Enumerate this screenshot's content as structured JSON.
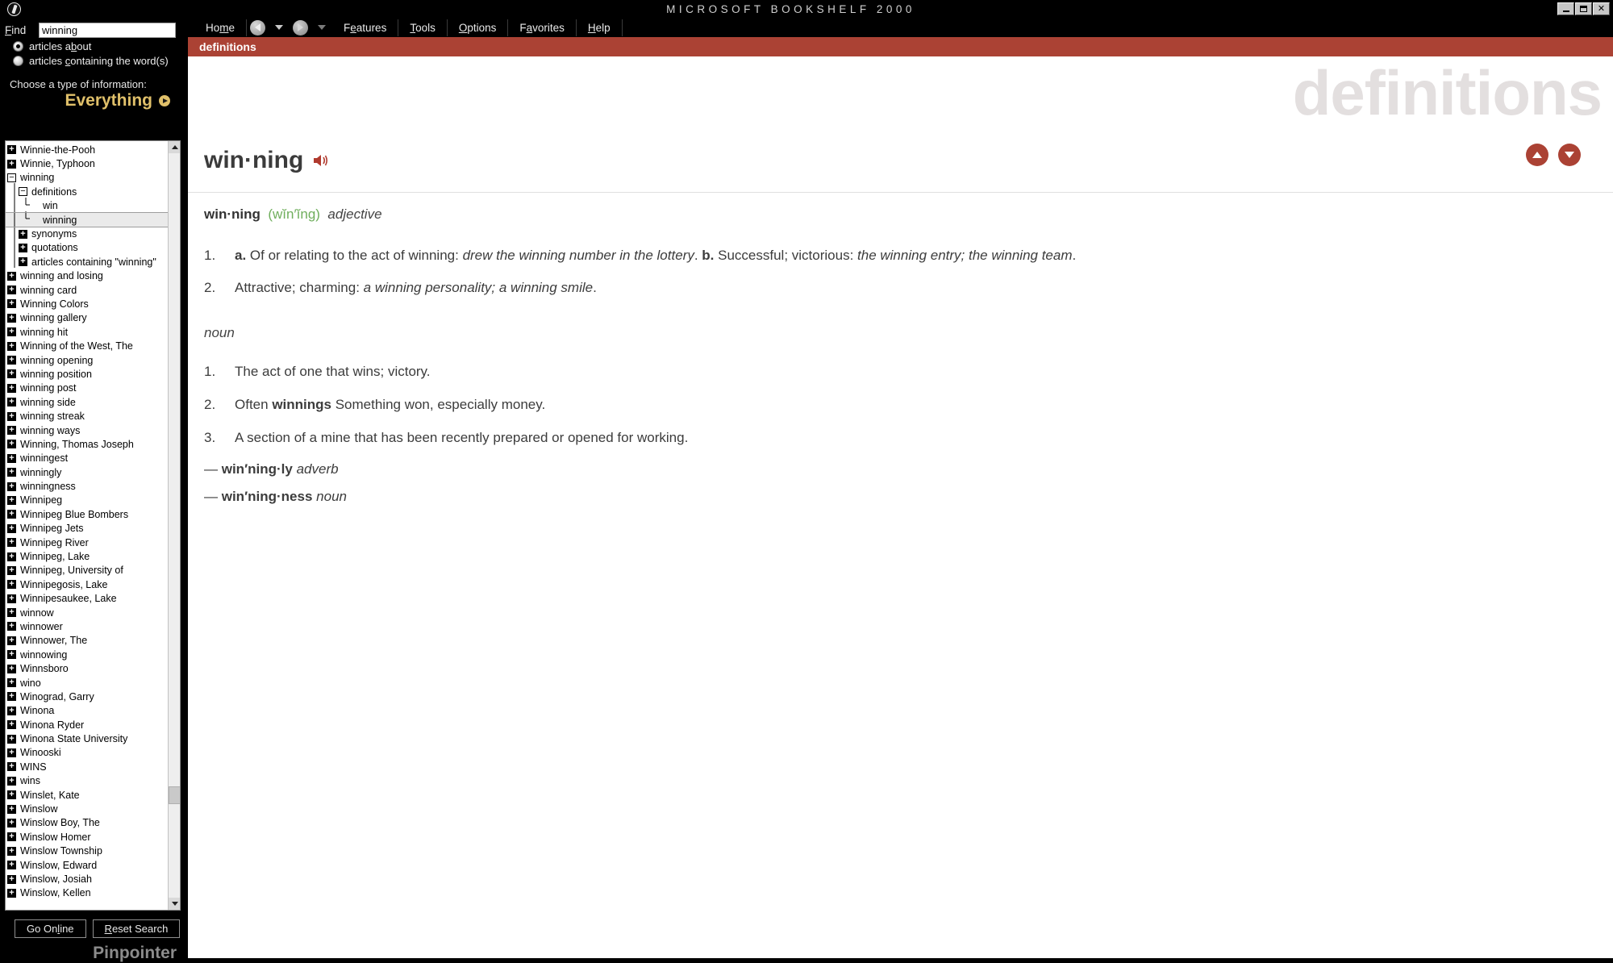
{
  "window": {
    "title": "MICROSOFT BOOKSHELF 2000",
    "logo_icon": "bookshelf-disc-icon",
    "controls": [
      {
        "name": "minimize-button",
        "glyph": "minimize-icon"
      },
      {
        "name": "maximize-button",
        "glyph": "maximize-icon"
      },
      {
        "name": "close-button",
        "glyph": "close-icon",
        "label": "×"
      }
    ]
  },
  "sidebar": {
    "find_label": "Find",
    "find_label_accel": "F",
    "find_value": "winning",
    "find_placeholder": "",
    "radios": [
      {
        "label": "articles about",
        "accel": "b",
        "selected": true
      },
      {
        "label": "articles containing the word(s)",
        "accel": "c",
        "selected": false
      }
    ],
    "choose_label": "Choose a type of information:",
    "type_value": "Everything",
    "type_arrow_icon": "arrow-right-circle-icon",
    "tree": [
      {
        "label": "Winnie-the-Pooh",
        "depth": 0,
        "expander": "plus"
      },
      {
        "label": "Winnie, Typhoon",
        "depth": 0,
        "expander": "plus"
      },
      {
        "label": "winning",
        "depth": 0,
        "expander": "minus"
      },
      {
        "label": "definitions",
        "depth": 1,
        "expander": "minus"
      },
      {
        "label": "win",
        "depth": 2,
        "expander": "leaf"
      },
      {
        "label": "winning",
        "depth": 2,
        "expander": "leaf-last",
        "selected": true
      },
      {
        "label": "synonyms",
        "depth": 1,
        "expander": "plus"
      },
      {
        "label": "quotations",
        "depth": 1,
        "expander": "plus"
      },
      {
        "label": "articles containing \"winning\"",
        "depth": 1,
        "expander": "plus-last"
      },
      {
        "label": "winning and losing",
        "depth": 0,
        "expander": "plus"
      },
      {
        "label": "winning card",
        "depth": 0,
        "expander": "plus"
      },
      {
        "label": "Winning Colors",
        "depth": 0,
        "expander": "plus"
      },
      {
        "label": "winning gallery",
        "depth": 0,
        "expander": "plus"
      },
      {
        "label": "winning hit",
        "depth": 0,
        "expander": "plus"
      },
      {
        "label": "Winning of the West, The",
        "depth": 0,
        "expander": "plus"
      },
      {
        "label": "winning opening",
        "depth": 0,
        "expander": "plus"
      },
      {
        "label": "winning position",
        "depth": 0,
        "expander": "plus"
      },
      {
        "label": "winning post",
        "depth": 0,
        "expander": "plus"
      },
      {
        "label": "winning side",
        "depth": 0,
        "expander": "plus"
      },
      {
        "label": "winning streak",
        "depth": 0,
        "expander": "plus"
      },
      {
        "label": "winning ways",
        "depth": 0,
        "expander": "plus"
      },
      {
        "label": "Winning, Thomas Joseph",
        "depth": 0,
        "expander": "plus"
      },
      {
        "label": "winningest",
        "depth": 0,
        "expander": "plus"
      },
      {
        "label": "winningly",
        "depth": 0,
        "expander": "plus"
      },
      {
        "label": "winningness",
        "depth": 0,
        "expander": "plus"
      },
      {
        "label": "Winnipeg",
        "depth": 0,
        "expander": "plus"
      },
      {
        "label": "Winnipeg Blue Bombers",
        "depth": 0,
        "expander": "plus"
      },
      {
        "label": "Winnipeg Jets",
        "depth": 0,
        "expander": "plus"
      },
      {
        "label": "Winnipeg River",
        "depth": 0,
        "expander": "plus"
      },
      {
        "label": "Winnipeg, Lake",
        "depth": 0,
        "expander": "plus"
      },
      {
        "label": "Winnipeg, University of",
        "depth": 0,
        "expander": "plus"
      },
      {
        "label": "Winnipegosis, Lake",
        "depth": 0,
        "expander": "plus"
      },
      {
        "label": "Winnipesaukee, Lake",
        "depth": 0,
        "expander": "plus"
      },
      {
        "label": "winnow",
        "depth": 0,
        "expander": "plus"
      },
      {
        "label": "winnower",
        "depth": 0,
        "expander": "plus"
      },
      {
        "label": "Winnower, The",
        "depth": 0,
        "expander": "plus"
      },
      {
        "label": "winnowing",
        "depth": 0,
        "expander": "plus"
      },
      {
        "label": "Winnsboro",
        "depth": 0,
        "expander": "plus"
      },
      {
        "label": "wino",
        "depth": 0,
        "expander": "plus"
      },
      {
        "label": "Winograd, Garry",
        "depth": 0,
        "expander": "plus"
      },
      {
        "label": "Winona",
        "depth": 0,
        "expander": "plus"
      },
      {
        "label": "Winona Ryder",
        "depth": 0,
        "expander": "plus"
      },
      {
        "label": "Winona State University",
        "depth": 0,
        "expander": "plus"
      },
      {
        "label": "Winooski",
        "depth": 0,
        "expander": "plus"
      },
      {
        "label": "WINS",
        "depth": 0,
        "expander": "plus"
      },
      {
        "label": "wins",
        "depth": 0,
        "expander": "plus"
      },
      {
        "label": "Winslet, Kate",
        "depth": 0,
        "expander": "plus"
      },
      {
        "label": "Winslow",
        "depth": 0,
        "expander": "plus"
      },
      {
        "label": "Winslow Boy, The",
        "depth": 0,
        "expander": "plus"
      },
      {
        "label": "Winslow Homer",
        "depth": 0,
        "expander": "plus"
      },
      {
        "label": "Winslow Township",
        "depth": 0,
        "expander": "plus"
      },
      {
        "label": "Winslow, Edward",
        "depth": 0,
        "expander": "plus"
      },
      {
        "label": "Winslow, Josiah",
        "depth": 0,
        "expander": "plus"
      },
      {
        "label": "Winslow, Kellen",
        "depth": 0,
        "expander": "plus"
      }
    ],
    "go_online_label": "Go Online",
    "go_online_accel": "l",
    "reset_search_label": "Reset Search",
    "reset_search_accel": "R",
    "pinpointer_label": "Pinpointer"
  },
  "menubar": {
    "home_label": "Home",
    "home_accel": "m",
    "back_icon": "back-arrow-icon",
    "back_dropdown_icon": "chevron-down-icon",
    "forward_icon": "forward-arrow-icon",
    "forward_dropdown_icon": "chevron-down-icon",
    "items": [
      {
        "label": "Features",
        "accel": "e"
      },
      {
        "label": "Tools",
        "accel": "T"
      },
      {
        "label": "Options",
        "accel": "O"
      },
      {
        "label": "Favorites",
        "accel": "a"
      },
      {
        "label": "Help",
        "accel": "H"
      }
    ]
  },
  "banner": {
    "tab_label": "definitions",
    "watermark": "definitions",
    "color": "#ab4234",
    "nav_up_icon": "arrow-up-circle-icon",
    "nav_down_icon": "arrow-down-circle-icon"
  },
  "article": {
    "headword": "win·ning",
    "audio_icon": "speaker-icon",
    "entry_headword": "win·ning",
    "pronunciation": "(wĭn′ĭng)",
    "part_of_speech_1": "adjective",
    "adjective_senses": [
      {
        "num": "1.",
        "parts": [
          {
            "text": "a.",
            "style": "bold"
          },
          {
            "text": " Of or relating to the act of winning: ",
            "style": "plain"
          },
          {
            "text": "drew the winning number in the lottery",
            "style": "italic"
          },
          {
            "text": ". ",
            "style": "plain"
          },
          {
            "text": "b.",
            "style": "bold"
          },
          {
            "text": " Successful; victorious: ",
            "style": "plain"
          },
          {
            "text": "the winning entry; the winning team",
            "style": "italic"
          },
          {
            "text": ".",
            "style": "plain"
          }
        ]
      },
      {
        "num": "2.",
        "parts": [
          {
            "text": "Attractive; charming: ",
            "style": "plain"
          },
          {
            "text": "a winning personality; a winning smile",
            "style": "italic"
          },
          {
            "text": ".",
            "style": "plain"
          }
        ]
      }
    ],
    "part_of_speech_2": "noun",
    "noun_senses": [
      {
        "num": "1.",
        "parts": [
          {
            "text": "The act of one that wins; victory.",
            "style": "plain"
          }
        ]
      },
      {
        "num": "2.",
        "parts": [
          {
            "text": "Often ",
            "style": "plain"
          },
          {
            "text": "winnings",
            "style": "bold"
          },
          {
            "text": " Something won, especially money.",
            "style": "plain"
          }
        ]
      },
      {
        "num": "3.",
        "parts": [
          {
            "text": "A section of a mine that has been recently prepared or opened for working.",
            "style": "plain"
          }
        ]
      }
    ],
    "derived_forms": [
      {
        "dash": "—",
        "word": "win′ning·ly",
        "pos": "adverb"
      },
      {
        "dash": "—",
        "word": "win′ning·ness",
        "pos": "noun"
      }
    ]
  }
}
